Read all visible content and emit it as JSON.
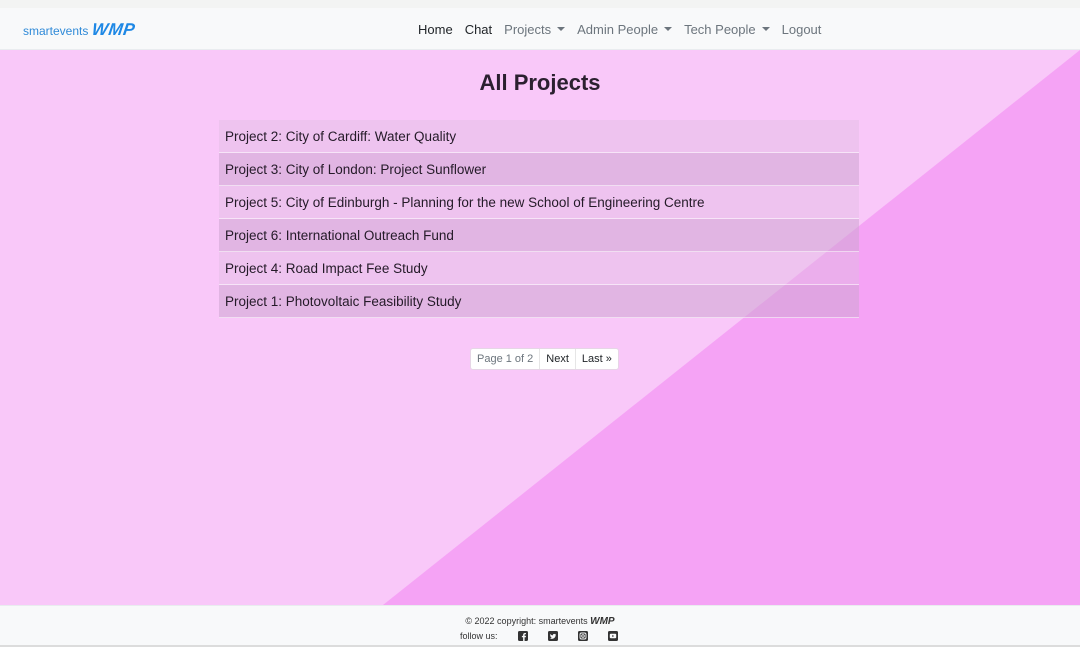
{
  "brand": {
    "text": "smartevents",
    "logo": "WMP"
  },
  "nav": {
    "home": "Home",
    "chat": "Chat",
    "projects": "Projects",
    "admin_people": "Admin People",
    "tech_people": "Tech People",
    "logout": "Logout"
  },
  "page": {
    "title": "All Projects"
  },
  "projects": [
    "Project 2: City of Cardiff: Water Quality",
    "Project 3: City of London: Project Sunflower",
    "Project 5: City of Edinburgh - Planning for the new School of Engineering Centre",
    "Project 6: International Outreach Fund",
    "Project 4: Road Impact Fee Study",
    "Project 1: Photovoltaic Feasibility Study"
  ],
  "pagination": {
    "info": "Page 1 of 2",
    "next": "Next",
    "last": "Last »"
  },
  "footer": {
    "copyright": "© 2022 copyright: smartevents",
    "logo": "WMP",
    "follow": "follow us:",
    "icons": [
      "facebook-icon",
      "twitter-icon",
      "instagram-icon",
      "youtube-icon"
    ]
  },
  "colors": {
    "background": "#f9c8f9",
    "diagonal": "#f5a3f5",
    "brand": "#1e88e5"
  }
}
